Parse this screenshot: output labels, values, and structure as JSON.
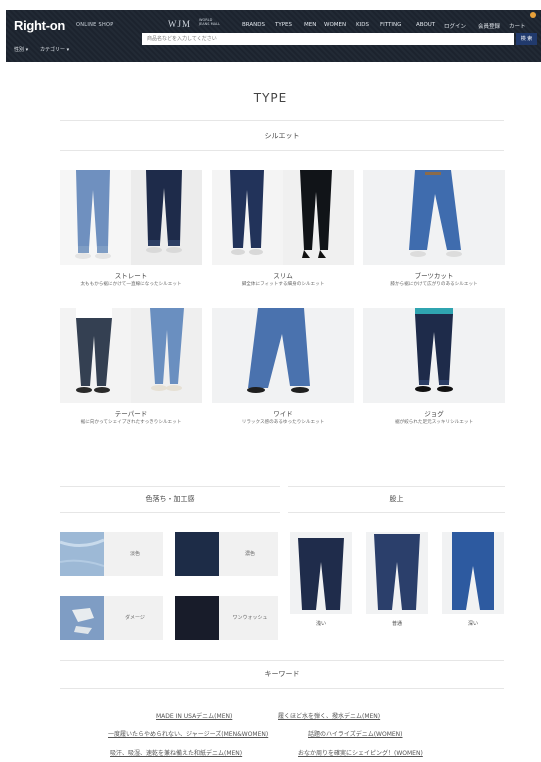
{
  "header": {
    "logo": "Right-on",
    "logo_sub": "ONLINE SHOP",
    "wjm": "WJM",
    "wjm_sub": "WORLD JEANS MALL",
    "nav": [
      "BRANDS",
      "TYPES",
      "MEN",
      "WOMEN",
      "KIDS",
      "FITTING",
      "ABOUT",
      "ログイン",
      "会員登録",
      "カート"
    ],
    "subnav": [
      "性別 ▾",
      "カテゴリー ▾"
    ],
    "search_placeholder": "商品名などを入力してください",
    "search_button": "検 索"
  },
  "page_title": "TYPE",
  "silhouette": {
    "title": "シルエット",
    "items": [
      {
        "name": "ストレート",
        "desc": "太ももから裾にかけて一直線になったシルエット"
      },
      {
        "name": "スリム",
        "desc": "脚全体にフィットする細身のシルエット"
      },
      {
        "name": "ブーツカット",
        "desc": "膝から裾にかけて広がりのあるシルエット"
      },
      {
        "name": "テーパード",
        "desc": "裾に向かってシェイプされたすっきりシルエット"
      },
      {
        "name": "ワイド",
        "desc": "リラックス感のあるゆったりシルエット"
      },
      {
        "name": "ジョグ",
        "desc": "裾が絞られた足元スッキリシルエット"
      }
    ]
  },
  "wash": {
    "title": "色落ち・加工感",
    "items": [
      {
        "label": "淡色",
        "color": "#9db9d6"
      },
      {
        "label": "濃色",
        "color": "#1d2c47"
      },
      {
        "label": "ダメージ",
        "color": "#7f9dc4"
      },
      {
        "label": "ワンウォッシュ",
        "color": "#181c2a"
      }
    ]
  },
  "rise": {
    "title": "股上",
    "items": [
      {
        "label": "浅い"
      },
      {
        "label": "普通"
      },
      {
        "label": "深い"
      }
    ]
  },
  "keywords": {
    "title": "キーワード",
    "links": [
      "MADE IN USAデニム(MEN)",
      "履くほど水を弾く、撥水デニム(MEN)",
      "一度履いたらやめられない、ジャージーズ(MEN&WOMEN)",
      "話題のハイライズデニム(WOMEN)",
      "吸汗、吸湿、速乾を兼ね備えた和紙デニム(MEN)",
      "おなか周りを確実にシェイピング！(WOMEN)"
    ]
  },
  "colors": {
    "header_bg": "#1d2530",
    "accent": "#e8a13a",
    "search_btn": "#213a6d",
    "denim_light": "#6f90bf",
    "denim_mid": "#3f5f93",
    "denim_dark": "#1e2b4a"
  }
}
